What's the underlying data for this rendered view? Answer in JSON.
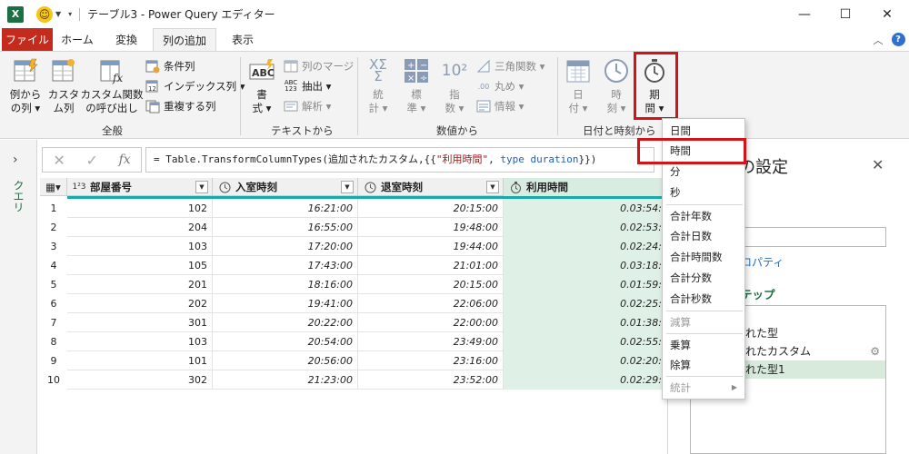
{
  "window": {
    "title": "テーブル3 - Power Query エディター",
    "app_icon": "excel-icon",
    "controls": {
      "minimize": "—",
      "maximize": "☐",
      "close": "✕"
    }
  },
  "tabs": [
    {
      "label": "ファイル"
    },
    {
      "label": "ホーム"
    },
    {
      "label": "変換"
    },
    {
      "label": "列の追加"
    },
    {
      "label": "表示"
    }
  ],
  "ribbon": {
    "groups": [
      {
        "label": "全般"
      },
      {
        "label": "テキストから"
      },
      {
        "label": "数値から"
      },
      {
        "label": "日付と時刻から"
      }
    ],
    "general": {
      "example_column": {
        "l1": "例から",
        "l2": "の列 ▾"
      },
      "custom_column": {
        "l1": "カスタ",
        "l2": "ム列"
      },
      "invoke_custom_function": {
        "l1": "カスタム関数",
        "l2": "の呼び出し"
      },
      "conditional_column": "条件列",
      "index_column": "インデックス列 ▾",
      "duplicate_column": "重複する列"
    },
    "text": {
      "format": {
        "l1": "書",
        "l2": "式 ▾"
      },
      "merge_columns": "列のマージ",
      "extract": "抽出 ▾",
      "parse": "解析 ▾"
    },
    "number": {
      "statistics": {
        "l1": "統",
        "l2": "計 ▾"
      },
      "standard": {
        "l1": "標",
        "l2": "準 ▾"
      },
      "scientific": {
        "l1": "指",
        "l2": "数 ▾"
      },
      "trigonometry": "三角関数 ▾",
      "rounding": "丸め ▾",
      "information": "情報 ▾"
    },
    "datetime": {
      "date": {
        "l1": "日",
        "l2": "付 ▾"
      },
      "time": {
        "l1": "時",
        "l2": "刻 ▾"
      },
      "duration": {
        "l1": "期",
        "l2": "間 ▾"
      }
    }
  },
  "query_pane": {
    "label": "クエリ"
  },
  "formula_bar": {
    "prefix": "= Table.TransformColumnTypes(追加されたカスタム,{{",
    "string": "\"利用時間\"",
    "comma": ", ",
    "type_kw": "type",
    "type_val": " duration",
    "suffix": "}})"
  },
  "grid": {
    "columns": [
      {
        "type_icon": "1²3",
        "name": "部屋番号"
      },
      {
        "type_icon": "clock",
        "name": "入室時刻"
      },
      {
        "type_icon": "clock",
        "name": "退室時刻"
      },
      {
        "type_icon": "stopwatch",
        "name": "利用時間"
      }
    ],
    "rows": [
      {
        "idx": "1",
        "room": "102",
        "in": "16:21:00",
        "out": "20:15:00",
        "dur": "0.03:54:"
      },
      {
        "idx": "2",
        "room": "204",
        "in": "16:55:00",
        "out": "19:48:00",
        "dur": "0.02:53:"
      },
      {
        "idx": "3",
        "room": "103",
        "in": "17:20:00",
        "out": "19:44:00",
        "dur": "0.02:24:"
      },
      {
        "idx": "4",
        "room": "105",
        "in": "17:43:00",
        "out": "21:01:00",
        "dur": "0.03:18:"
      },
      {
        "idx": "5",
        "room": "201",
        "in": "18:16:00",
        "out": "20:15:00",
        "dur": "0.01:59:"
      },
      {
        "idx": "6",
        "room": "202",
        "in": "19:41:00",
        "out": "22:06:00",
        "dur": "0.02:25:"
      },
      {
        "idx": "7",
        "room": "301",
        "in": "20:22:00",
        "out": "22:00:00",
        "dur": "0.01:38:"
      },
      {
        "idx": "8",
        "room": "103",
        "in": "20:54:00",
        "out": "23:49:00",
        "dur": "0.02:55:"
      },
      {
        "idx": "9",
        "room": "101",
        "in": "20:56:00",
        "out": "23:16:00",
        "dur": "0.02:20:"
      },
      {
        "idx": "10",
        "room": "302",
        "in": "21:23:00",
        "out": "23:52:00",
        "dur": "0.02:29:"
      }
    ]
  },
  "settings": {
    "title_visible": "の設定",
    "properties_link": "ロパティ",
    "steps_heading": "テップ",
    "steps": [
      {
        "label": "れた型"
      },
      {
        "label": "れたカスタム"
      },
      {
        "label": "れた型1"
      }
    ]
  },
  "duration_menu": {
    "items": [
      {
        "label": "日間",
        "enabled": true
      },
      {
        "label": "時間",
        "enabled": true
      },
      {
        "label": "分",
        "enabled": true
      },
      {
        "label": "秒",
        "enabled": true
      },
      {
        "label": "合計年数",
        "enabled": true
      },
      {
        "label": "合計日数",
        "enabled": true
      },
      {
        "label": "合計時間数",
        "enabled": true
      },
      {
        "label": "合計分数",
        "enabled": true
      },
      {
        "label": "合計秒数",
        "enabled": true
      },
      {
        "label": "減算",
        "enabled": false
      },
      {
        "label": "乗算",
        "enabled": true
      },
      {
        "label": "除算",
        "enabled": true
      },
      {
        "label": "統計",
        "enabled": false
      }
    ]
  },
  "colors": {
    "accent_green": "#1d6f42",
    "file_tab": "#c42b1c",
    "highlight_box": "#d0141a",
    "selected_column": "#dff0e6"
  }
}
